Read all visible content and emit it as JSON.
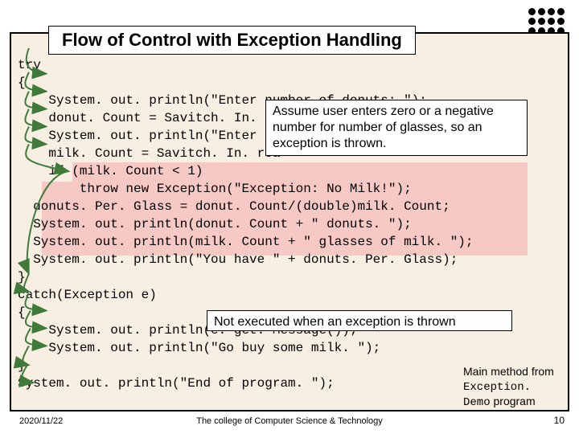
{
  "title": "Flow of Control with Exception Handling",
  "code": {
    "l1": "try",
    "l2": "{",
    "l3": "    System. out. println(\"Enter number of donuts: \");",
    "l4": "    donut. Count = Savitch. In. re",
    "l5": "    System. out. println(\"Enter",
    "l6": "    milk. Count = Savitch. In. rea",
    "l7": "    if (milk. Count < 1)",
    "l8": "        throw new Exception(\"Exception: No Milk!\");",
    "l9": "  donuts. Per. Glass = donut. Count/(double)milk. Count;",
    "l10": "  System. out. println(donut. Count + \" donuts. \");",
    "l11": "  System. out. println(milk. Count + \" glasses of milk. \");",
    "l12": "  System. out. println(\"You have \" + donuts. Per. Glass);",
    "l13": "}",
    "l14": "catch(Exception e)",
    "l15": "{",
    "l16": "    System. out. println(e. get. Message());",
    "l17": "    System. out. println(\"Go buy some milk. \");",
    "l18": "}",
    "l19": "System. out. println(\"End of program. \");"
  },
  "callouts": {
    "c1": "Assume user enters zero or a negative number for number of glasses, so an exception is thrown.",
    "c2": "Not executed when an exception is thrown"
  },
  "sidecap": {
    "line1": "Main method from",
    "line2_mono": "Exception.",
    "line3_mono": "Demo",
    "line3_rest": " program"
  },
  "footer": {
    "date": "2020/11/22",
    "center": "The college of Computer Science & Technology",
    "page": "10"
  }
}
